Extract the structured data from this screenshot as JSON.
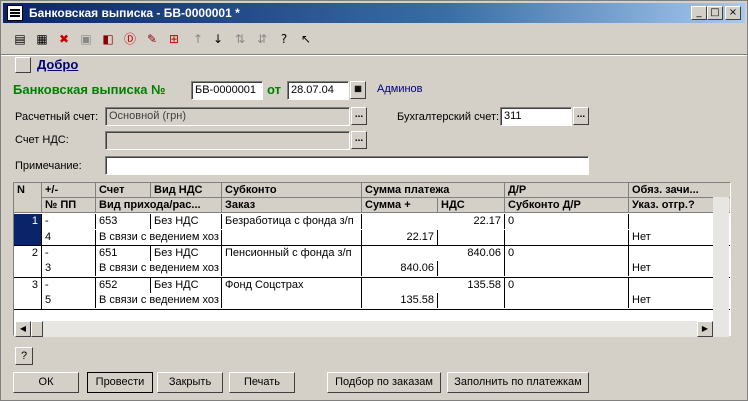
{
  "window": {
    "title": "Банковская выписка - БВ-0000001 *"
  },
  "link_label": "Добро",
  "header": {
    "doc_title": "Банковская выписка №",
    "doc_number": "БВ-0000001",
    "from_label": "от",
    "doc_date": "28.07.04",
    "user": "Админов"
  },
  "form": {
    "account_label": "Расчетный счет:",
    "account_value": "Основной (грн)",
    "acc_account_label": "Бухгалтерский счет:",
    "acc_account_value": "311",
    "vat_account_label": "Счет НДС:",
    "vat_account_value": "",
    "note_label": "Примечание:",
    "note_value": ""
  },
  "table": {
    "headers_row1": [
      "N",
      "+/-",
      "Счет",
      "Вид НДС",
      "Субконто",
      "Сумма платежа",
      "Д/Р",
      "Обяз. зачи..."
    ],
    "headers_row2": [
      "№ ПП",
      "Вид прихода/рас...",
      "Заказ",
      "Сумма +",
      "НДС",
      "Субконто Д/Р",
      "Указ. отгр.?"
    ],
    "rows": [
      {
        "n": "1",
        "sign": "-",
        "account": "653",
        "vat_type": "Без НДС",
        "subconto": "Безработица с фонда з/п",
        "amount": "22.17",
        "dr": "0",
        "pp": "4",
        "kind": "В связи с ведением хоз",
        "order": "",
        "amount_plus": "22.17",
        "vat": "",
        "sub_dr": "",
        "shipment": "Нет"
      },
      {
        "n": "2",
        "sign": "-",
        "account": "651",
        "vat_type": "Без НДС",
        "subconto": "Пенсионный с фонда з/п",
        "amount": "840.06",
        "dr": "0",
        "pp": "3",
        "kind": "В связи с ведением хоз",
        "order": "",
        "amount_plus": "840.06",
        "vat": "",
        "sub_dr": "",
        "shipment": "Нет"
      },
      {
        "n": "3",
        "sign": "-",
        "account": "652",
        "vat_type": "Без НДС",
        "subconto": "Фонд Соцстрах",
        "amount": "135.58",
        "dr": "0",
        "pp": "5",
        "kind": "В связи с ведением хоз",
        "order": "",
        "amount_plus": "135.58",
        "vat": "",
        "sub_dr": "",
        "shipment": "Нет"
      }
    ]
  },
  "help_button": "?",
  "buttons": {
    "ok": "ОК",
    "post": "Провести",
    "close": "Закрыть",
    "print": "Печать",
    "select_orders": "Подбор по заказам",
    "fill_payments": "Заполнить по платежкам"
  },
  "colors": {
    "title_green": "#008000",
    "titlebar": "#0a246a",
    "link": "#000080"
  }
}
